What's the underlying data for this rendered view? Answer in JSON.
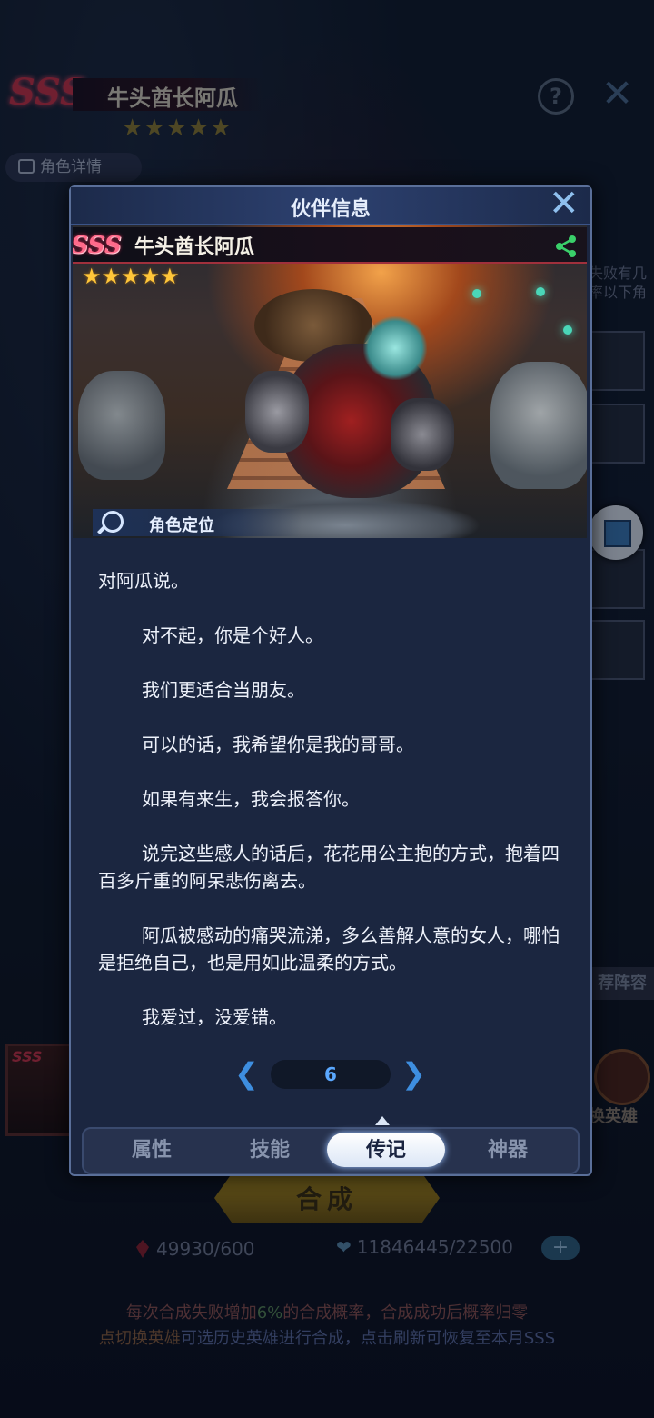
{
  "background": {
    "hero_name": "牛头酋长阿瓜",
    "rank": "SSS",
    "stars": "★★★★★",
    "detail_button": "角色详情",
    "help_icon": "?",
    "close_icon": "✕",
    "side_text": "失败有几率以下角",
    "recommended_lineup": "荐阵容",
    "switch_hero": "换英雄",
    "compose_button": "合成",
    "resource_gems": "49930/600",
    "resource_hearts": "11846445/22500",
    "plus": "+",
    "tip_line1_a": "每次合成失败增加",
    "tip_line1_pct": "6%",
    "tip_line1_b": "的合成概率，合成成功后概率归零",
    "tip_line2_a": "点切换英雄",
    "tip_line2_b": "可选历史英雄进行合成，点击刷新可恢复至本月SSS"
  },
  "dialog": {
    "title": "伙伴信息",
    "close_icon": "✕",
    "rank": "SSS",
    "hero_name": "牛头酋长阿瓜",
    "stars": "★★★★★",
    "role_label": "角色定位",
    "bio": [
      "对阿瓜说。",
      "对不起，你是个好人。",
      "我们更适合当朋友。",
      "可以的话，我希望你是我的哥哥。",
      "如果有来生，我会报答你。",
      "说完这些感人的话后，花花用公主抱的方式，抱着四百多斤重的阿呆悲伤离去。",
      "阿瓜被感动的痛哭流涕，多么善解人意的女人，哪怕是拒绝自己，也是用如此温柔的方式。",
      "我爱过，没爱错。"
    ],
    "page": "6",
    "prev": "❮",
    "next": "❯"
  },
  "tabs": [
    {
      "label": "属性",
      "active": false
    },
    {
      "label": "技能",
      "active": false
    },
    {
      "label": "传记",
      "active": true
    },
    {
      "label": "神器",
      "active": false
    }
  ],
  "colors": {
    "accent": "#3e8ee0",
    "star": "#ffc63a",
    "sss": "#ff6a8a",
    "panel": "#1b2640"
  }
}
